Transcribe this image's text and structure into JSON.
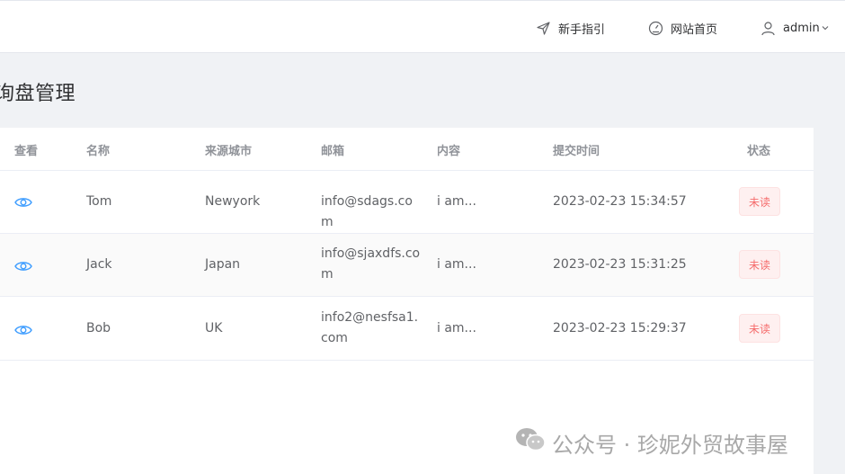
{
  "header": {
    "guide_label": "新手指引",
    "home_label": "网站首页",
    "user_label": "admin"
  },
  "page": {
    "title": "询盘管理"
  },
  "table": {
    "columns": {
      "view": "查看",
      "name": "名称",
      "city": "来源城市",
      "email": "邮箱",
      "content": "内容",
      "time": "提交时间",
      "status": "状态"
    },
    "rows": [
      {
        "name": "Tom",
        "city": "Newyork",
        "email": "info@sdags.com",
        "content": "i am...",
        "time": "2023-02-23 15:34:57",
        "status": "未读"
      },
      {
        "name": "Jack",
        "city": "Japan",
        "email": "info@sjaxdfs.com",
        "content": "i am...",
        "time": "2023-02-23 15:31:25",
        "status": "未读"
      },
      {
        "name": "Bob",
        "city": "UK",
        "email": "info2@nesfsa1.com",
        "content": "i am...",
        "time": "2023-02-23 15:29:37",
        "status": "未读"
      }
    ]
  },
  "watermark": {
    "text": "公众号 · 珍妮外贸故事屋"
  },
  "colors": {
    "accent": "#409eff",
    "status_unread_text": "#f56c6c",
    "status_unread_bg": "#fef0f0"
  }
}
